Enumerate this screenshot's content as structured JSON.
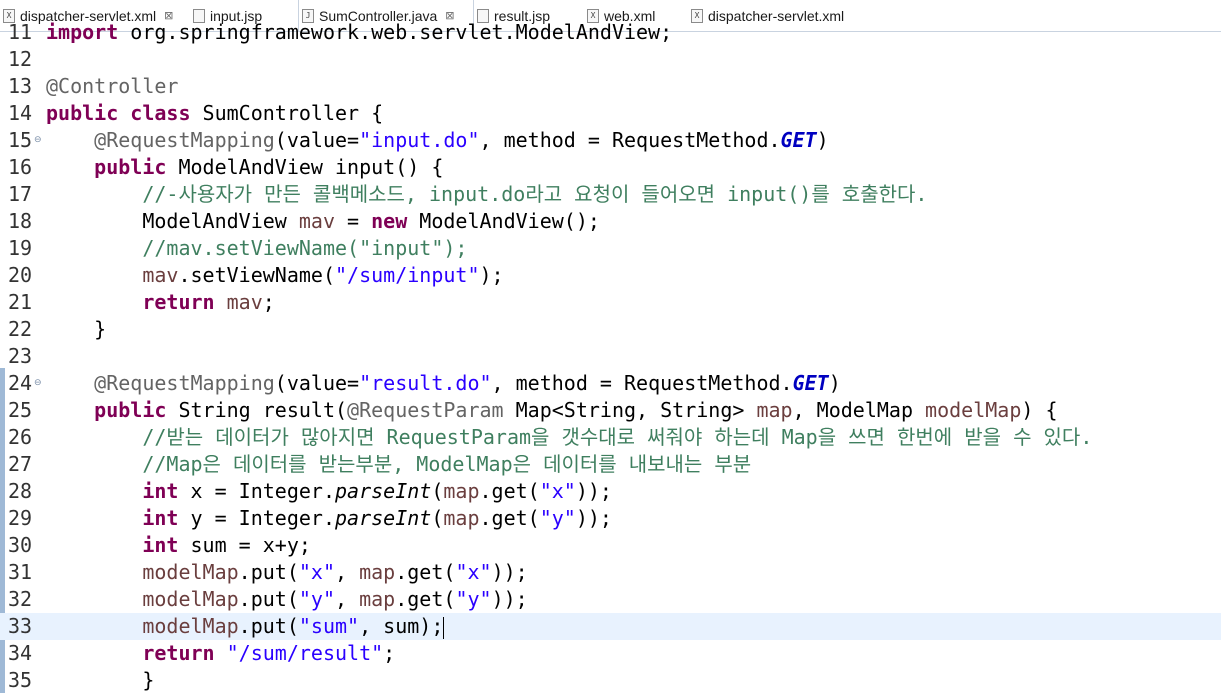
{
  "tabs": [
    {
      "label": "dispatcher-servlet.xml",
      "icon": "xml-file-icon",
      "icon_glyph": "X",
      "active": false,
      "close": "⊠"
    },
    {
      "label": "input.jsp",
      "icon": "jsp-file-icon",
      "icon_glyph": "",
      "active": false
    },
    {
      "label": "SumController.java",
      "icon": "java-file-icon",
      "icon_glyph": "J",
      "active": true,
      "close": "⊠"
    },
    {
      "label": "result.jsp",
      "icon": "jsp-file-icon",
      "icon_glyph": "",
      "active": false
    },
    {
      "label": "web.xml",
      "icon": "xml-file-icon",
      "icon_glyph": "X",
      "active": false
    },
    {
      "label": "dispatcher-servlet.xml",
      "icon": "xml-file-icon",
      "icon_glyph": "X",
      "active": false
    }
  ],
  "fold_glyph": "⊖",
  "lines": [
    {
      "n": "11",
      "tokens": [
        {
          "t": "import ",
          "c": "kw"
        },
        {
          "t": "org.springframework.web.servlet.ModelAndView;"
        }
      ]
    },
    {
      "n": "12",
      "tokens": []
    },
    {
      "n": "13",
      "tokens": [
        {
          "t": "@Controller",
          "c": "an"
        }
      ]
    },
    {
      "n": "14",
      "tokens": [
        {
          "t": "public ",
          "c": "kw"
        },
        {
          "t": "class ",
          "c": "kw"
        },
        {
          "t": "SumController {"
        }
      ]
    },
    {
      "n": "15",
      "fold": true,
      "tokens": [
        {
          "t": "    "
        },
        {
          "t": "@RequestMapping",
          "c": "an"
        },
        {
          "t": "(value="
        },
        {
          "t": "\"input.do\"",
          "c": "st"
        },
        {
          "t": ", method = RequestMethod."
        },
        {
          "t": "GET",
          "c": "fld"
        },
        {
          "t": ")"
        }
      ]
    },
    {
      "n": "16",
      "tokens": [
        {
          "t": "    "
        },
        {
          "t": "public ",
          "c": "kw"
        },
        {
          "t": "ModelAndView input() {"
        }
      ]
    },
    {
      "n": "17",
      "tokens": [
        {
          "t": "        "
        },
        {
          "t": "//-사용자가 만든 콜백메소드, input.do라고 요청이 들어오면 input()를 호출한다.",
          "c": "cm"
        }
      ]
    },
    {
      "n": "18",
      "tokens": [
        {
          "t": "        ModelAndView "
        },
        {
          "t": "mav",
          "c": "var"
        },
        {
          "t": " = "
        },
        {
          "t": "new ",
          "c": "kw"
        },
        {
          "t": "ModelAndView();"
        }
      ]
    },
    {
      "n": "19",
      "tokens": [
        {
          "t": "        "
        },
        {
          "t": "//mav.setViewName(\"input\");",
          "c": "cm"
        }
      ]
    },
    {
      "n": "20",
      "tokens": [
        {
          "t": "        "
        },
        {
          "t": "mav",
          "c": "var"
        },
        {
          "t": ".setViewName("
        },
        {
          "t": "\"/sum/input\"",
          "c": "st"
        },
        {
          "t": ");"
        }
      ]
    },
    {
      "n": "21",
      "tokens": [
        {
          "t": "        "
        },
        {
          "t": "return ",
          "c": "kw"
        },
        {
          "t": "mav",
          "c": "var"
        },
        {
          "t": ";"
        }
      ]
    },
    {
      "n": "22",
      "tokens": [
        {
          "t": "    }"
        }
      ]
    },
    {
      "n": "23",
      "tokens": []
    },
    {
      "n": "24",
      "fold": true,
      "tokens": [
        {
          "t": "    "
        },
        {
          "t": "@RequestMapping",
          "c": "an"
        },
        {
          "t": "(value="
        },
        {
          "t": "\"result.do\"",
          "c": "st"
        },
        {
          "t": ", method = RequestMethod."
        },
        {
          "t": "GET",
          "c": "fld"
        },
        {
          "t": ")"
        }
      ]
    },
    {
      "n": "25",
      "tokens": [
        {
          "t": "    "
        },
        {
          "t": "public ",
          "c": "kw"
        },
        {
          "t": "String result("
        },
        {
          "t": "@RequestParam",
          "c": "an"
        },
        {
          "t": " Map<String, String> "
        },
        {
          "t": "map",
          "c": "var"
        },
        {
          "t": ", ModelMap "
        },
        {
          "t": "modelMap",
          "c": "var"
        },
        {
          "t": ") {"
        }
      ]
    },
    {
      "n": "26",
      "tokens": [
        {
          "t": "        "
        },
        {
          "t": "//받는 데이터가 많아지면 RequestParam을 갯수대로 써줘야 하는데 Map을 쓰면 한번에 받을 수 있다.",
          "c": "cm"
        }
      ]
    },
    {
      "n": "27",
      "tokens": [
        {
          "t": "        "
        },
        {
          "t": "//Map은 데이터를 받는부분, ModelMap은 데이터를 내보내는 부분",
          "c": "cm"
        }
      ]
    },
    {
      "n": "28",
      "tokens": [
        {
          "t": "        "
        },
        {
          "t": "int ",
          "c": "kw"
        },
        {
          "t": "x = Integer."
        },
        {
          "t": "parseInt",
          "c": "it"
        },
        {
          "t": "("
        },
        {
          "t": "map",
          "c": "var"
        },
        {
          "t": ".get("
        },
        {
          "t": "\"x\"",
          "c": "st"
        },
        {
          "t": "));"
        }
      ]
    },
    {
      "n": "29",
      "tokens": [
        {
          "t": "        "
        },
        {
          "t": "int ",
          "c": "kw"
        },
        {
          "t": "y = Integer."
        },
        {
          "t": "parseInt",
          "c": "it"
        },
        {
          "t": "("
        },
        {
          "t": "map",
          "c": "var"
        },
        {
          "t": ".get("
        },
        {
          "t": "\"y\"",
          "c": "st"
        },
        {
          "t": "));"
        }
      ]
    },
    {
      "n": "30",
      "tokens": [
        {
          "t": "        "
        },
        {
          "t": "int ",
          "c": "kw"
        },
        {
          "t": "sum = x+y;"
        }
      ]
    },
    {
      "n": "31",
      "tokens": [
        {
          "t": "        "
        },
        {
          "t": "modelMap",
          "c": "var"
        },
        {
          "t": ".put("
        },
        {
          "t": "\"x\"",
          "c": "st"
        },
        {
          "t": ", "
        },
        {
          "t": "map",
          "c": "var"
        },
        {
          "t": ".get("
        },
        {
          "t": "\"x\"",
          "c": "st"
        },
        {
          "t": "));"
        }
      ]
    },
    {
      "n": "32",
      "tokens": [
        {
          "t": "        "
        },
        {
          "t": "modelMap",
          "c": "var"
        },
        {
          "t": ".put("
        },
        {
          "t": "\"y\"",
          "c": "st"
        },
        {
          "t": ", "
        },
        {
          "t": "map",
          "c": "var"
        },
        {
          "t": ".get("
        },
        {
          "t": "\"y\"",
          "c": "st"
        },
        {
          "t": "));"
        }
      ]
    },
    {
      "n": "33",
      "current": true,
      "tokens": [
        {
          "t": "        "
        },
        {
          "t": "modelMap",
          "c": "var"
        },
        {
          "t": ".put("
        },
        {
          "t": "\"sum\"",
          "c": "st"
        },
        {
          "t": ", sum);"
        }
      ]
    },
    {
      "n": "34",
      "tokens": [
        {
          "t": "        "
        },
        {
          "t": "return ",
          "c": "kw"
        },
        {
          "t": "\"/sum/result\"",
          "c": "st"
        },
        {
          "t": ";"
        }
      ]
    },
    {
      "n": "35",
      "tokens": [
        {
          "t": "        }"
        }
      ]
    }
  ]
}
